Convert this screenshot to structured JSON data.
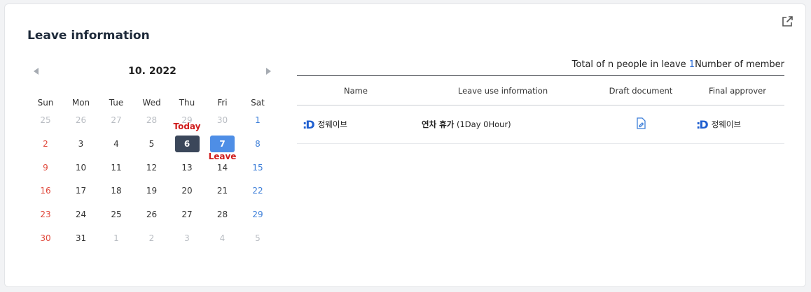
{
  "header": {
    "title": "Leave information"
  },
  "calendar": {
    "month_label": "10. 2022",
    "weekdays": [
      "Sun",
      "Mon",
      "Tue",
      "Wed",
      "Thu",
      "Fri",
      "Sat"
    ],
    "weeks": [
      [
        "25",
        "26",
        "27",
        "28",
        "29",
        "30",
        "1"
      ],
      [
        "2",
        "3",
        "4",
        "5",
        "6",
        "7",
        "8"
      ],
      [
        "9",
        "10",
        "11",
        "12",
        "13",
        "14",
        "15"
      ],
      [
        "16",
        "17",
        "18",
        "19",
        "20",
        "21",
        "22"
      ],
      [
        "23",
        "24",
        "25",
        "26",
        "27",
        "28",
        "29"
      ],
      [
        "30",
        "31",
        "1",
        "2",
        "3",
        "4",
        "5"
      ]
    ],
    "today_label": "Today",
    "leave_label": "Leave"
  },
  "summary": {
    "prefix": "Total of n people in leave ",
    "count": "1",
    "suffix": "Number of member"
  },
  "table": {
    "columns": [
      "Name",
      "Leave use information",
      "Draft document",
      "Final approver"
    ],
    "rows": [
      {
        "logo": ":D",
        "name": "정웨이브",
        "leave_type": "연차 휴가",
        "leave_detail": "(1Day 0Hour)",
        "approver_logo": ":D",
        "approver": "정웨이브"
      }
    ]
  },
  "colors": {
    "today_bg": "#3b475a",
    "leave_bg": "#4e8ee6",
    "sunday": "#e0473a",
    "saturday": "#3d7fd9",
    "tag": "#d01c1c"
  },
  "icons": {
    "external": "external-link-icon",
    "prev": "chevron-left-icon",
    "next": "chevron-right-icon",
    "draft": "document-edit-icon"
  }
}
